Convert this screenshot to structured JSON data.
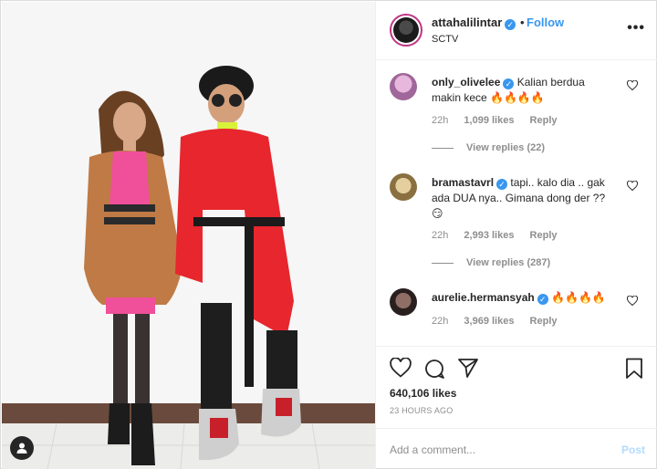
{
  "post": {
    "username": "attahalilintar",
    "verified": true,
    "dot": "•",
    "follow_label": "Follow",
    "location": "SCTV"
  },
  "comments": [
    {
      "username": "only_olivelee",
      "verified": true,
      "text": "Kalian berdua makin kece 🔥🔥🔥🔥",
      "time": "22h",
      "likes": "1,099 likes",
      "reply_label": "Reply",
      "view_replies": "View replies (22)",
      "avatar_color": "#c98bc4"
    },
    {
      "username": "bramastavrl",
      "verified": true,
      "text": "tapi.. kalo dia .. gak ada DUA nya.. Gimana dong der ??😏",
      "time": "22h",
      "likes": "2,993 likes",
      "reply_label": "Reply",
      "view_replies": "View replies (287)",
      "avatar_color": "#c9a86a"
    },
    {
      "username": "aurelie.hermansyah",
      "verified": true,
      "text": "🔥🔥🔥🔥",
      "time": "22h",
      "likes": "3,969 likes",
      "reply_label": "Reply",
      "avatar_color": "#3a2a2a"
    }
  ],
  "actions": {
    "likes_count": "640,106 likes",
    "time_ago": "23 HOURS AGO"
  },
  "add_comment": {
    "placeholder": "Add a comment...",
    "post_label": "Post"
  },
  "colors": {
    "accent": "#3897f0",
    "muted": "#8e8e8e",
    "text": "#262626",
    "post_disabled": "#b3dbff"
  },
  "icons": [
    "three-dots-icon",
    "verified-badge-icon",
    "heart-icon",
    "comment-icon",
    "share-icon",
    "bookmark-icon",
    "user-tag-icon"
  ]
}
